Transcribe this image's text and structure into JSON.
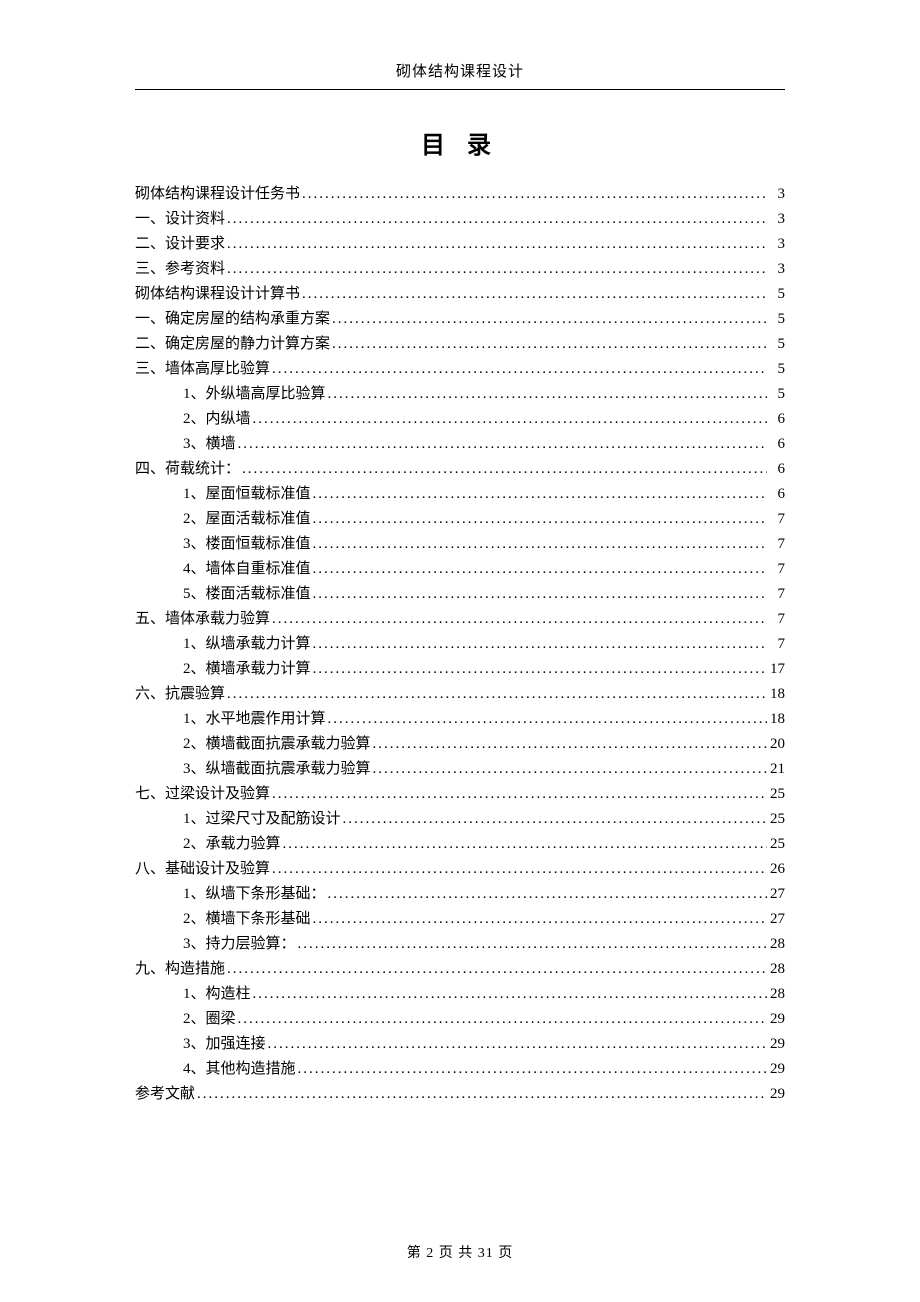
{
  "header_title": "砌体结构课程设计",
  "toc_title": "目 录",
  "footer": "第 2 页 共 31 页",
  "toc": [
    {
      "level": 0,
      "text": "砌体结构课程设计任务书",
      "page": "3"
    },
    {
      "level": 0,
      "text": "一、设计资料",
      "page": "3"
    },
    {
      "level": 0,
      "text": "二、设计要求",
      "page": "3"
    },
    {
      "level": 0,
      "text": "三、参考资料",
      "page": "3"
    },
    {
      "level": 0,
      "text": "砌体结构课程设计计算书",
      "page": "5"
    },
    {
      "level": 0,
      "text": "一、确定房屋的结构承重方案",
      "page": "5"
    },
    {
      "level": 0,
      "text": "二、确定房屋的静力计算方案",
      "page": "5"
    },
    {
      "level": 0,
      "text": "三、墙体高厚比验算",
      "page": "5"
    },
    {
      "level": 1,
      "text": "1、外纵墙高厚比验算",
      "page": "5"
    },
    {
      "level": 1,
      "text": "2、内纵墙",
      "page": "6"
    },
    {
      "level": 1,
      "text": "3、横墙",
      "page": "6"
    },
    {
      "level": 0,
      "text": "四、荷载统计：",
      "page": "6"
    },
    {
      "level": 1,
      "text": "1、屋面恒载标准值",
      "page": "6"
    },
    {
      "level": 1,
      "text": "2、屋面活载标准值",
      "page": "7"
    },
    {
      "level": 1,
      "text": "3、楼面恒载标准值",
      "page": "7"
    },
    {
      "level": 1,
      "text": "4、墙体自重标准值",
      "page": "7"
    },
    {
      "level": 1,
      "text": "5、楼面活载标准值",
      "page": "7"
    },
    {
      "level": 0,
      "text": "五、墙体承载力验算",
      "page": "7"
    },
    {
      "level": 1,
      "text": "1、纵墙承载力计算",
      "page": "7"
    },
    {
      "level": 1,
      "text": "2、横墙承载力计算",
      "page": "17"
    },
    {
      "level": 0,
      "text": "六、抗震验算",
      "page": "18"
    },
    {
      "level": 1,
      "text": "1、水平地震作用计算",
      "page": "18"
    },
    {
      "level": 1,
      "text": "2、横墙截面抗震承载力验算",
      "page": "20"
    },
    {
      "level": 1,
      "text": "3、纵墙截面抗震承载力验算",
      "page": "21"
    },
    {
      "level": 0,
      "text": "七、过梁设计及验算",
      "page": "25"
    },
    {
      "level": 1,
      "text": "1、过梁尺寸及配筋设计",
      "page": "25"
    },
    {
      "level": 1,
      "text": "2、承载力验算",
      "page": "25"
    },
    {
      "level": 0,
      "text": "八、基础设计及验算",
      "page": "26"
    },
    {
      "level": 1,
      "text": "1、纵墙下条形基础：",
      "page": "27"
    },
    {
      "level": 1,
      "text": "2、横墙下条形基础",
      "page": "27"
    },
    {
      "level": 1,
      "text": "3、持力层验算：",
      "page": "28"
    },
    {
      "level": 0,
      "text": "九、构造措施",
      "page": "28"
    },
    {
      "level": 1,
      "text": "1、构造柱",
      "page": "28"
    },
    {
      "level": 1,
      "text": "2、圈梁",
      "page": "29"
    },
    {
      "level": 1,
      "text": "3、加强连接",
      "page": "29"
    },
    {
      "level": 1,
      "text": "4、其他构造措施",
      "page": "29"
    },
    {
      "level": 0,
      "text": "参考文献",
      "page": "29"
    }
  ]
}
